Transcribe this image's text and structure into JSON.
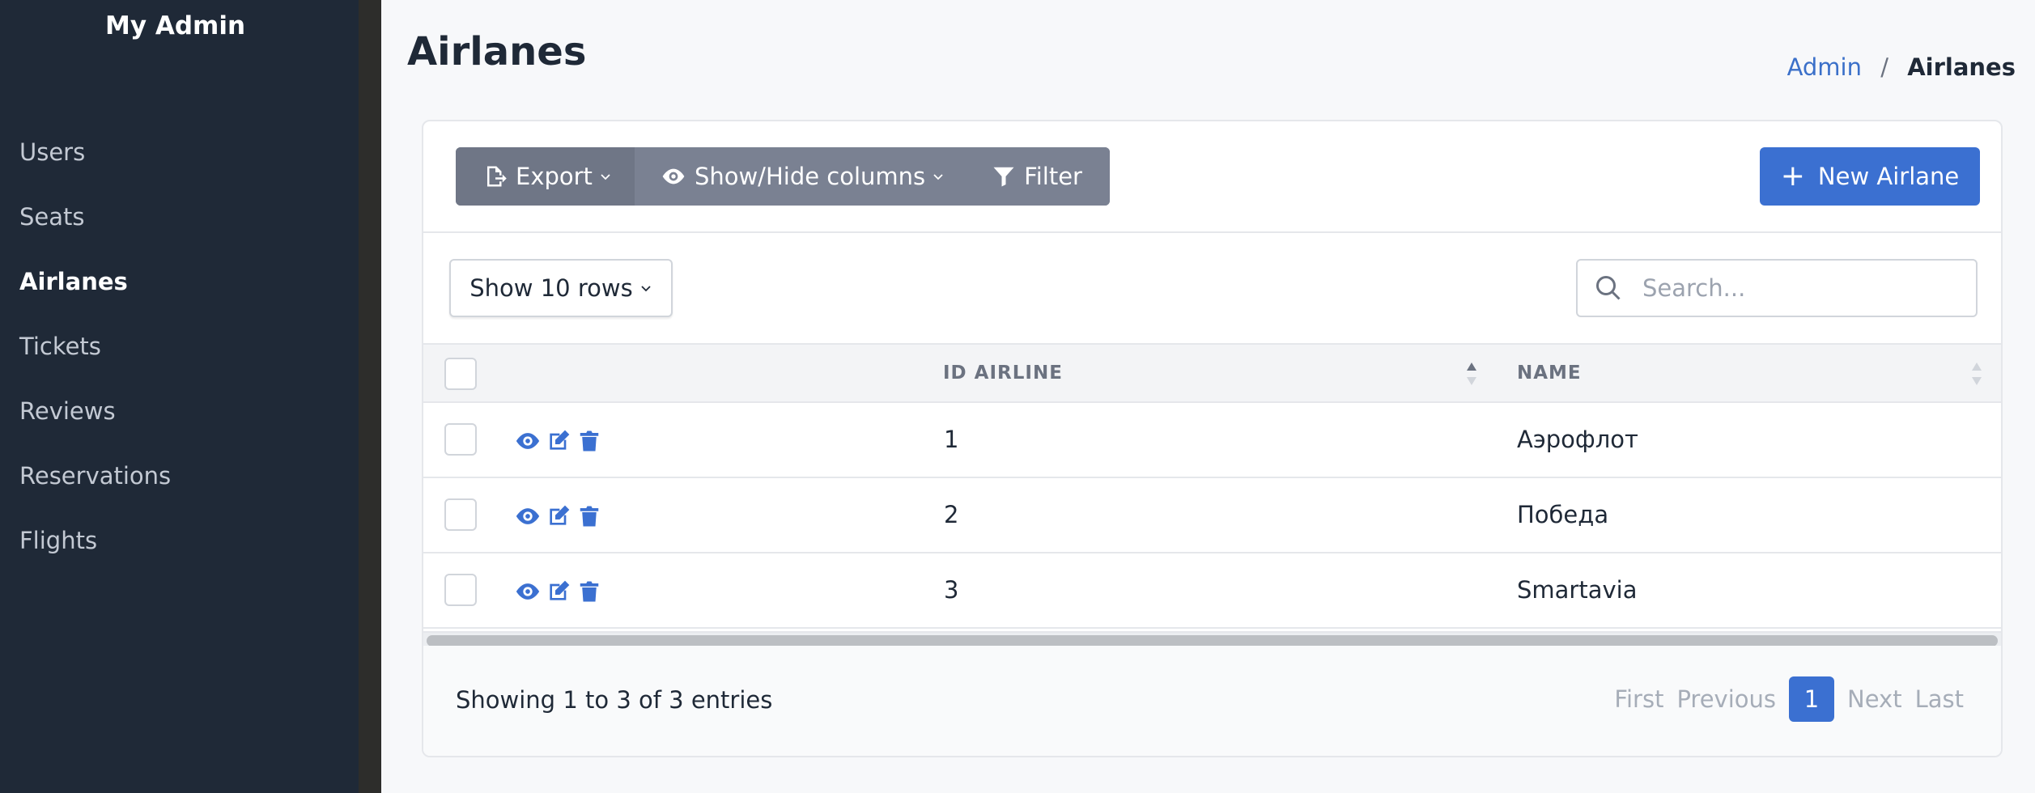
{
  "app": {
    "title": "My Admin"
  },
  "sidebar": {
    "items": [
      {
        "label": "Users",
        "active": false
      },
      {
        "label": "Seats",
        "active": false
      },
      {
        "label": "Airlanes",
        "active": true
      },
      {
        "label": "Tickets",
        "active": false
      },
      {
        "label": "Reviews",
        "active": false
      },
      {
        "label": "Reservations",
        "active": false
      },
      {
        "label": "Flights",
        "active": false
      }
    ]
  },
  "header": {
    "title": "Airlanes",
    "breadcrumb": {
      "root": "Admin",
      "separator": "/",
      "current": "Airlanes"
    }
  },
  "toolbar": {
    "export_label": "Export",
    "showhide_label": "Show/Hide columns",
    "filter_label": "Filter",
    "new_label": "New Airlane"
  },
  "controls": {
    "rows_label": "Show 10 rows",
    "search_placeholder": "Search..."
  },
  "table": {
    "columns": [
      "ID AIRLINE",
      "NAME"
    ],
    "rows": [
      {
        "id": "1",
        "name": "Аэрофлот"
      },
      {
        "id": "2",
        "name": "Победа"
      },
      {
        "id": "3",
        "name": "Smartavia"
      }
    ]
  },
  "footer": {
    "info": "Showing 1 to 3 of 3 entries",
    "pagination": {
      "first": "First",
      "previous": "Previous",
      "current": "1",
      "next": "Next",
      "last": "Last"
    }
  },
  "colors": {
    "sidebar_bg": "#1f2937",
    "accent": "#3b70d1",
    "toolbar_btn": "#6f7686"
  }
}
